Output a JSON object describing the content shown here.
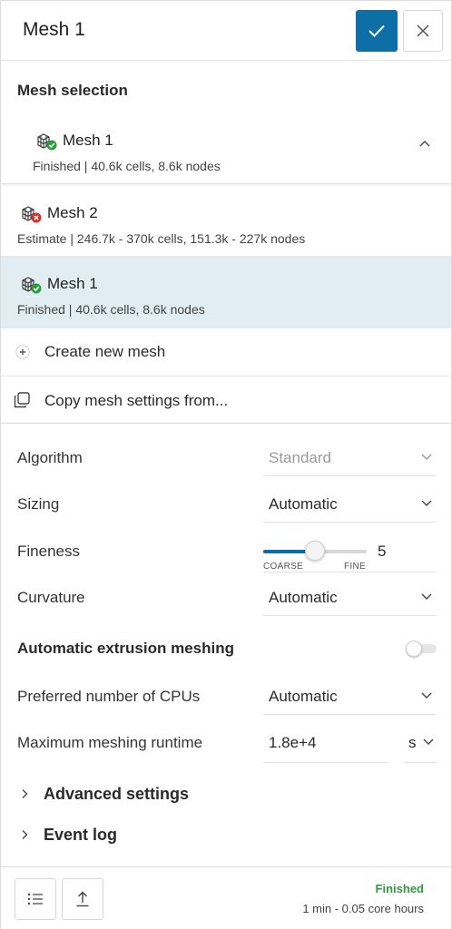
{
  "header": {
    "title": "Mesh 1"
  },
  "mesh_selection": {
    "title": "Mesh selection",
    "selected": {
      "name": "Mesh 1",
      "subtitle": "Finished | 40.6k cells, 8.6k nodes",
      "status": "finished"
    },
    "options": [
      {
        "name": "Mesh 2",
        "subtitle": "Estimate | 246.7k - 370k cells, 151.3k - 227k nodes",
        "status": "error"
      },
      {
        "name": "Mesh 1",
        "subtitle": "Finished | 40.6k cells, 8.6k nodes",
        "status": "finished"
      }
    ],
    "create_label": "Create new mesh",
    "copy_label": "Copy mesh settings from..."
  },
  "settings": {
    "algorithm": {
      "label": "Algorithm",
      "value": "Standard",
      "disabled": true
    },
    "sizing": {
      "label": "Sizing",
      "value": "Automatic"
    },
    "fineness": {
      "label": "Fineness",
      "value": "5",
      "fraction": 0.5,
      "min_label": "COARSE",
      "max_label": "FINE"
    },
    "curvature": {
      "label": "Curvature",
      "value": "Automatic"
    },
    "extrusion": {
      "label": "Automatic extrusion meshing",
      "enabled": false
    },
    "cpus": {
      "label": "Preferred number of CPUs",
      "value": "Automatic"
    },
    "runtime": {
      "label": "Maximum meshing runtime",
      "value": "1.8e+4",
      "unit": "s"
    }
  },
  "expanders": {
    "advanced": "Advanced settings",
    "event_log": "Event log"
  },
  "footer": {
    "status": "Finished",
    "detail": "1 min - 0.05 core hours"
  },
  "colors": {
    "accent": "#0d6fa6",
    "success": "#2e9b3e",
    "error": "#d0342c",
    "selected_bg": "#e1edf3"
  }
}
